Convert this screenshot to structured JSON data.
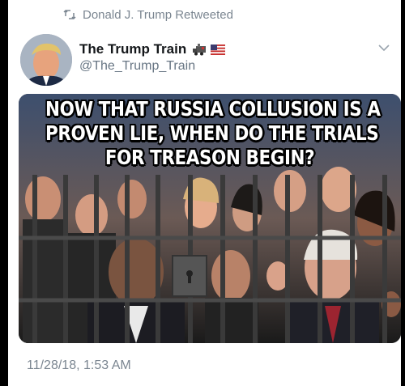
{
  "retweet": {
    "icon": "retweet-icon",
    "label": "Donald J. Trump Retweeted"
  },
  "author": {
    "name": "The Trump Train",
    "name_emoji": [
      "train-icon",
      "us-flag-icon"
    ],
    "handle": "@The_Trump_Train",
    "avatar": "avatar-photo"
  },
  "menu": {
    "icon": "chevron-down-icon"
  },
  "meme": {
    "caption_lines": [
      "NOW THAT RUSSIA COLLUSION IS A",
      "PROVEN LIE, WHEN DO THE TRIALS",
      "FOR TREASON BEGIN?"
    ]
  },
  "timestamp": "11/28/18, 1:53 AM",
  "colors": {
    "secondary_text": "#7b8691",
    "name_text": "#14171a",
    "background": "#ffffff"
  }
}
